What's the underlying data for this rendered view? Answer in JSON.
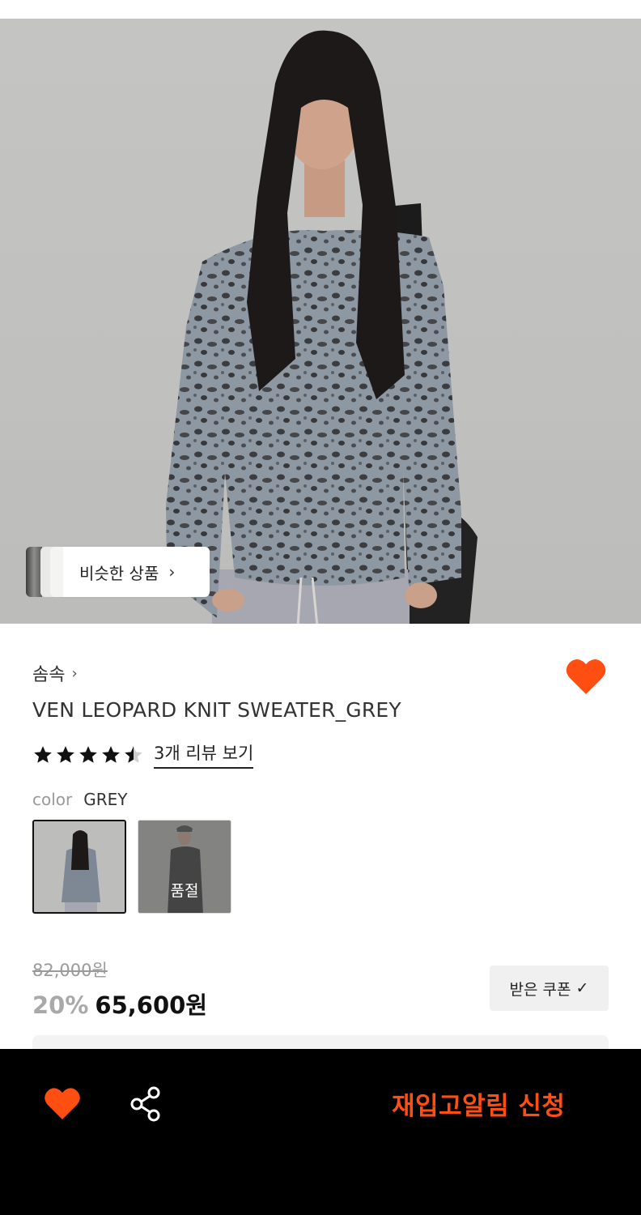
{
  "hero": {
    "image_alt": "Model wearing grey leopard knit sweater",
    "similar_products_label": "비슷한 상품",
    "chevron": "›"
  },
  "product": {
    "brand": "솜속",
    "brand_chevron": "›",
    "title": "VEN LEOPARD KNIT SWEATER_GREY",
    "rating": 4.5,
    "rating_max": 5,
    "reviews_label": "3개 리뷰 보기",
    "color_key": "color",
    "color_value": "GREY",
    "swatches": [
      {
        "name": "grey",
        "selected": true,
        "soldout": false
      },
      {
        "name": "black",
        "selected": false,
        "soldout": true,
        "soldout_label": "품절"
      }
    ],
    "original_price": "82,000원",
    "discount": "20%",
    "price": "65,600원",
    "coupon_label": "받은 쿠폰",
    "coupon_check": "✓"
  },
  "bottom_bar": {
    "restock_label": "재입고알림 신청"
  },
  "colors": {
    "accent": "#ff4e12",
    "bottom_bar_bg": "#000000",
    "discount_grey": "#a9a9a9"
  },
  "icons": [
    "chevron-right-icon",
    "heart-icon",
    "star-icon",
    "share-icon",
    "check-icon"
  ]
}
